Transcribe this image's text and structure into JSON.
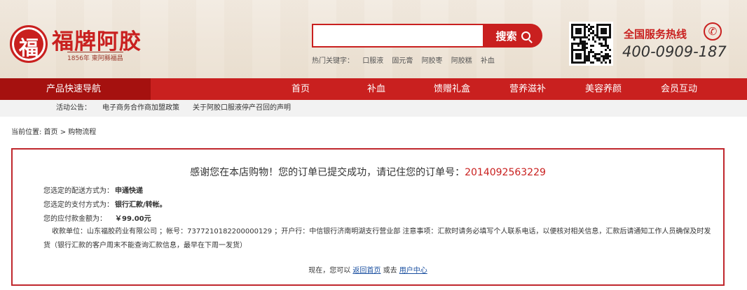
{
  "header": {
    "logo_char": "福",
    "logo_name": "福牌阿胶",
    "logo_sub": "1856年 東阿縣福昌",
    "search_placeholder": "",
    "search_label": "搜索",
    "hot_label": "热门关键字：",
    "hot_keywords": [
      "口服液",
      "固元膏",
      "阿胶枣",
      "阿胶糕",
      "补血"
    ],
    "hotline_title": "全国服务热线",
    "hotline_number": "400-0909-187"
  },
  "nav": {
    "category_label": "产品快速导航",
    "items": [
      "首页",
      "补血",
      "馈赠礼盒",
      "营养滋补",
      "美容养颜",
      "会员互动"
    ]
  },
  "notice": {
    "label": "活动公告：",
    "items": [
      "电子商务合作商加盟政策",
      "关于阿胶口服液停产召回的声明"
    ]
  },
  "breadcrumb": {
    "text": "当前位置: 首页 > 购物流程"
  },
  "order": {
    "thanks_text": "感谢您在本店购物！您的订单已提交成功，请记住您的订单号：",
    "order_number": "2014092563229",
    "shipping_label": "您选定的配送方式为：",
    "shipping_value": "申通快递",
    "payment_label": "您选定的支付方式为：",
    "payment_value": "银行汇款/转帐。",
    "amount_label": "您的应付款金额为：",
    "amount_value": "￥99.00元",
    "bank_info": "收款单位：山东福胶药业有限公司 ；帐号：7377210182200000129 ；开户行：中信银行济南明湖支行营业部 注意事项：汇款时请务必填写个人联系电话，以便核对相关信息，汇款后请通知工作人员确保及时发货（银行汇款的客户周末不能查询汇款信息，最早在下周一发货）",
    "links_prefix": "现在，您可以",
    "back_home": "返回首页",
    "or_go": "或去",
    "user_center": "用户中心"
  },
  "colors": {
    "brand_red": "#c9201f",
    "nav_dark_red": "#a5110f",
    "link_blue": "#1a4fa0"
  }
}
